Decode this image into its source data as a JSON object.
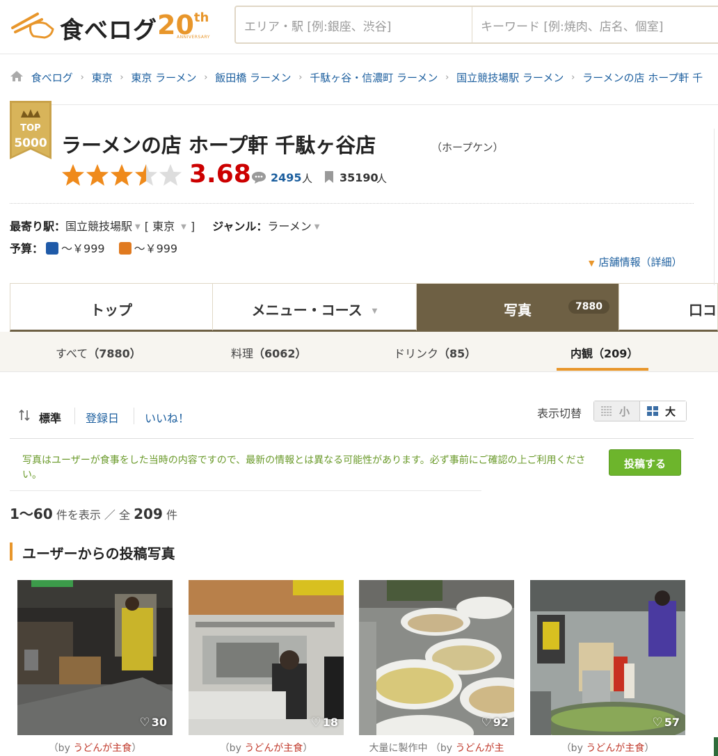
{
  "header": {
    "logo_text": "食べログ",
    "anniversary_number": "20",
    "anniversary_suffix": "th",
    "anniversary_label": "ANNIVERSARY",
    "search_area_placeholder": "エリア・駅 [例:銀座、渋谷]",
    "search_keyword_placeholder": "キーワード [例:焼肉、店名、個室]"
  },
  "breadcrumb": [
    "食べログ",
    "東京",
    "東京 ラーメン",
    "飯田橋 ラーメン",
    "千駄ヶ谷・信濃町 ラーメン",
    "国立競技場駅 ラーメン",
    "ラーメンの店 ホープ軒 千"
  ],
  "shop": {
    "badge_top": "TOP",
    "badge_num": "5000",
    "name": "ラーメンの店 ホープ軒 千駄ヶ谷店",
    "kana": "（ホープケン）",
    "rating": "3.68",
    "rating_value": 3.68,
    "reviews": "2495",
    "reviews_unit": "人",
    "saves": "35190",
    "saves_unit": "人"
  },
  "info": {
    "station_label": "最寄り駅：",
    "station": "国立競技場駅",
    "area": "[ 東京 ",
    "area_close": "]",
    "genre_label": "ジャンル：",
    "genre": "ラーメン",
    "budget_label": "予算：",
    "budget_dinner": "～￥999",
    "budget_lunch": "～￥999",
    "detail_link": "店舗情報（詳細）"
  },
  "tabs": {
    "top": "トップ",
    "menu": "メニュー・コース",
    "photo": "写真",
    "photo_count": "7880",
    "review": "口コミ"
  },
  "subtabs": {
    "all": "すべて",
    "all_count": "（7880）",
    "food": "料理",
    "food_count": "（6062）",
    "drink": "ドリンク",
    "drink_count": "（85）",
    "interior": "内観",
    "interior_count": "（209）"
  },
  "sort": {
    "standard": "標準",
    "date": "登録日",
    "like": "いいね！",
    "view_label": "表示切替",
    "view_small": "小",
    "view_large": "大"
  },
  "notice": {
    "text": "写真はユーザーが食事をした当時の内容ですので、最新の情報とは異なる可能性があります。必ず事前にご確認の上ご利用ください。",
    "post_button": "投稿する"
  },
  "count": {
    "range": "1～60",
    "shown_label": "件を表示 ／ 全",
    "total": "209",
    "unit": "件"
  },
  "section_title": "ユーザーからの投稿写真",
  "photos": [
    {
      "likes": "30",
      "caption_prefix": "（by ",
      "user": "うどんが主食",
      "caption_suffix": "）"
    },
    {
      "likes": "18",
      "caption_prefix": "（by ",
      "user": "うどんが主食",
      "caption_suffix": "）"
    },
    {
      "likes": "92",
      "caption_prefix": "大量に製作中 （by ",
      "user": "うどんが主",
      "caption_suffix": ""
    },
    {
      "likes": "57",
      "caption_prefix": "（by ",
      "user": "うどんが主食",
      "caption_suffix": "）"
    }
  ],
  "colors": {
    "accent": "#e8962b",
    "link": "#1b5e9e",
    "tab_active": "#6e6044",
    "score": "#cc0000",
    "post_button": "#6db52c"
  }
}
